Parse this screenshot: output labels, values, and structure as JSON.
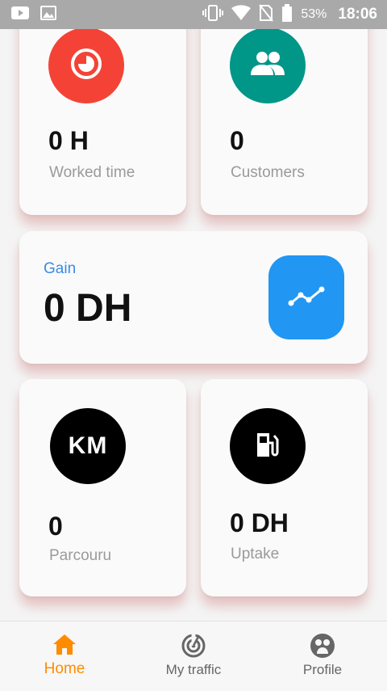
{
  "status_bar": {
    "icons": [
      "youtube-icon",
      "image-icon",
      "vibrate-icon",
      "wifi-icon",
      "no-sim-icon",
      "battery-icon"
    ],
    "battery": "53%",
    "time": "18:06"
  },
  "cards": {
    "worked": {
      "icon": "timer-icon",
      "color": "#f44336",
      "value": "0 H",
      "label": "Worked time"
    },
    "customers": {
      "icon": "people-icon",
      "color": "#009688",
      "value": "0",
      "label": "Customers"
    },
    "gain": {
      "title": "Gain",
      "value": "0 DH",
      "icon": "trend-line-icon",
      "color": "#2196f3"
    },
    "parcouru": {
      "icon_text": "KM",
      "color": "#000000",
      "value": "0",
      "label": "Parcouru"
    },
    "uptake": {
      "icon": "gas-station-icon",
      "color": "#000000",
      "value": "0 DH",
      "label": "Uptake"
    }
  },
  "nav": {
    "active_color": "#ff8c00",
    "items": [
      {
        "icon": "home-icon",
        "label": "Home",
        "active": true
      },
      {
        "icon": "radar-icon",
        "label": "My traffic",
        "active": false
      },
      {
        "icon": "profile-icon",
        "label": "Profile",
        "active": false
      }
    ]
  }
}
